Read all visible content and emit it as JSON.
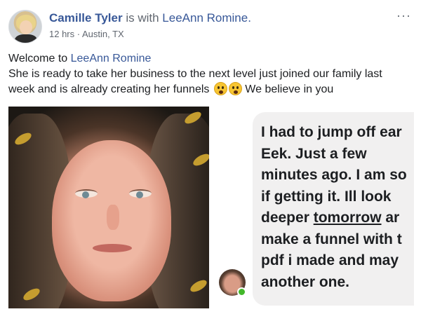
{
  "header": {
    "author": "Camille Tyler",
    "with_text": "is with",
    "tagged": "LeeAnn Romine.",
    "meta": "12 hrs · Austin, TX",
    "more_icon": "more-horizontal-icon",
    "more_label": "···"
  },
  "post": {
    "line1_prefix": "Welcome to ",
    "line1_mention": "LeeAnn Romine",
    "line2": "She is ready to take her business to the next level just joined our family last",
    "line3_before": "week and is already creating her funnels ",
    "line3_after": " We believe in you",
    "emojis": [
      "astonished-face-emoji",
      "astonished-face-emoji"
    ]
  },
  "screenshot_message": {
    "lines": [
      "I had to jump off ear",
      "Eek. Just a few",
      "minutes ago. I am so",
      "if getting it. Ill look",
      "deeper ",
      "make a funnel with t",
      "pdf i made and may",
      "another one."
    ],
    "underlined": "tomorrow",
    "after_underlined": " ar"
  },
  "colors": {
    "link": "#385898",
    "meta": "#616770",
    "bubble": "#f1f0f0",
    "online": "#42b72a"
  }
}
